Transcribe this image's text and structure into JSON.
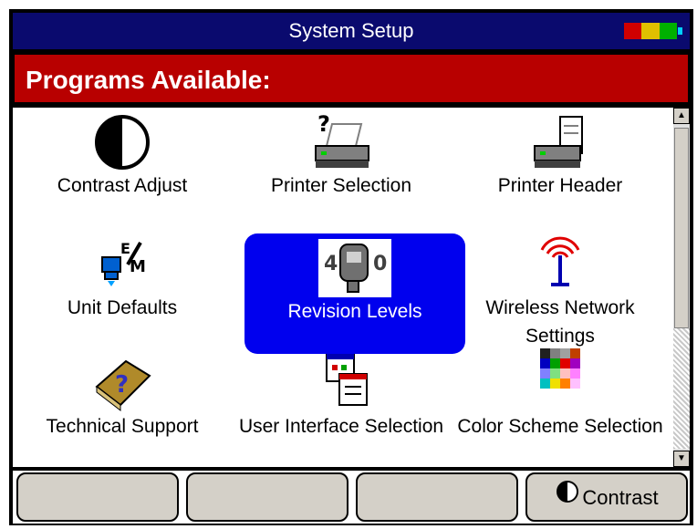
{
  "window": {
    "title": "System Setup"
  },
  "battery": {
    "colors": [
      "#d00000",
      "#e0c000",
      "#00b000",
      "#00d0ff"
    ]
  },
  "header": {
    "title": "Programs Available:"
  },
  "programs": [
    {
      "label": "Contrast Adjust",
      "icon": "contrast-icon"
    },
    {
      "label": "Printer Selection",
      "icon": "printer-question-icon"
    },
    {
      "label": "Printer Header",
      "icon": "printer-header-icon"
    },
    {
      "label": "Unit Defaults",
      "icon": "unit-defaults-icon"
    },
    {
      "label": "Revision Levels",
      "icon": "device-revision-icon",
      "selected": true
    },
    {
      "label": "Wireless Network Settings",
      "icon": "wireless-antenna-icon"
    },
    {
      "label": "Technical Support",
      "icon": "help-book-icon"
    },
    {
      "label": "User Interface Selection",
      "icon": "windows-icon"
    },
    {
      "label": "Color Scheme Selection",
      "icon": "color-grid-icon"
    }
  ],
  "softkeys": [
    {
      "label": ""
    },
    {
      "label": ""
    },
    {
      "label": ""
    },
    {
      "label": "Contrast",
      "icon": "contrast-icon"
    }
  ]
}
